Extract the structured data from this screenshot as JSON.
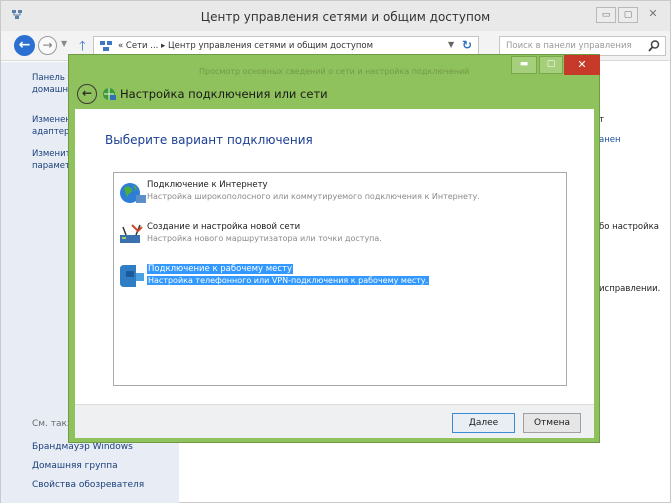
{
  "background_window": {
    "title": "Центр управления сетями и общим доступом",
    "controls": {
      "minimize": "▭",
      "maximize": "▢",
      "close": "✕"
    },
    "address": {
      "path": "« Сети ... ▸ Центр управления сетями и общим доступом",
      "search_placeholder": "Поиск в панели управления"
    },
    "sidebar": {
      "home": "Панель управления — домашняя страница",
      "adapter": "Изменение параметров адаптера",
      "sharing": "Изменить дополнительные параметры",
      "see_also": "См. также",
      "firewall": "Брандмауэр Windows",
      "homegroup": "Домашняя группа",
      "browser": "Свойства обозревателя"
    },
    "right_fragments": [
      "т",
      "анен",
      "бо настройка",
      "исправлении."
    ]
  },
  "dialog": {
    "title": "Настройка подключения или сети",
    "header_text": "Просмотр основных сведений о сети и настройка подключений",
    "controls": {
      "minimize": "▬",
      "maximize": "▢",
      "close": "✕"
    },
    "heading": "Выберите вариант подключения",
    "options": [
      {
        "title": "Подключение к Интернету",
        "desc": "Настройка широкополосного или коммутируемого подключения к Интернету."
      },
      {
        "title": "Создание и настройка новой сети",
        "desc": "Настройка нового маршрутизатора или точки доступа."
      },
      {
        "title": "Подключение к рабочему месту",
        "desc": "Настройка телефонного или VPN-подключения к рабочему месту."
      }
    ],
    "buttons": {
      "next": "Далее",
      "cancel": "Отмена"
    }
  },
  "colors": {
    "dialog_frame": "#8fc15c",
    "selection": "#3399ff",
    "heading_blue": "#1c3f94",
    "close_red": "#c73a2a"
  }
}
